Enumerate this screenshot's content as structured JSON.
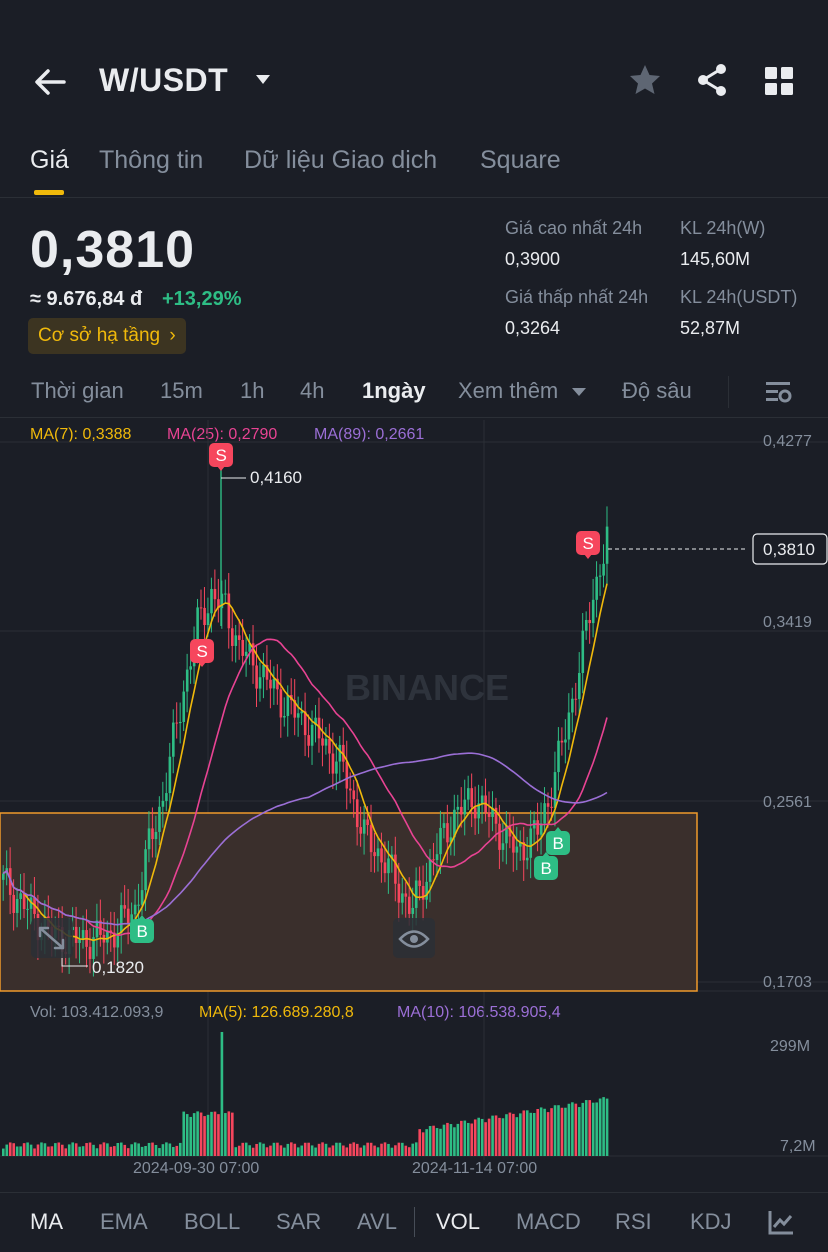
{
  "header": {
    "pair": "W/USDT"
  },
  "tabs": [
    "Giá",
    "Thông tin",
    "Dữ liệu Giao dịch",
    "Square"
  ],
  "price": {
    "last": "0,3810",
    "fiat": "≈ 9.676,84 đ",
    "change": "+13,29%",
    "tag": "Cơ sở hạ tầng"
  },
  "stats": {
    "high_label": "Giá cao nhất 24h",
    "high_value": "0,3900",
    "low_label": "Giá thấp nhất 24h",
    "low_value": "0,3264",
    "vol_base_label": "KL 24h(W)",
    "vol_base_value": "145,60M",
    "vol_quote_label": "KL 24h(USDT)",
    "vol_quote_value": "52,87M"
  },
  "intervals": {
    "time": "Thời gian",
    "m15": "15m",
    "h1": "1h",
    "h4": "4h",
    "d1": "1ngày",
    "more": "Xem thêm",
    "depth": "Độ sâu"
  },
  "ma_legend": {
    "ma7": "MA(7): 0,3388",
    "ma25": "MA(25): 0,2790",
    "ma89": "MA(89): 0,2661"
  },
  "vol_legend": {
    "vol": "Vol: 103.412.093,9",
    "ma5": "MA(5): 126.689.280,8",
    "ma10": "MA(10): 106.538.905,4"
  },
  "colors": {
    "up": "#2ebd85",
    "down": "#f6465d",
    "ma7": "#f0b90b",
    "ma25": "#e84393",
    "ma89": "#9b6fd6",
    "accent": "#f0b90b"
  },
  "watermark": "BINANCE",
  "chart_data": {
    "type": "candlestick",
    "y_ticks": [
      "0,4277",
      "0,3419",
      "0,2561",
      "0,1703"
    ],
    "y_range": [
      0.1703,
      0.4277
    ],
    "current_price_label": "0,3810",
    "high_annotation": "0,4160",
    "low_annotation": "0,1820",
    "vol_y_ticks": [
      "299M",
      "7,2M"
    ],
    "x_ticks": [
      "2024-09-30 07:00",
      "2024-11-14 07:00"
    ],
    "signals": [
      {
        "label": "S",
        "price": 0.416
      },
      {
        "label": "S",
        "price": 0.362
      },
      {
        "label": "S",
        "price": 0.386
      },
      {
        "label": "B",
        "price": 0.184
      },
      {
        "label": "B",
        "price": 0.222
      },
      {
        "label": "B",
        "price": 0.233
      }
    ],
    "series": [
      {
        "name": "MA(7)"
      },
      {
        "name": "MA(25)"
      },
      {
        "name": "MA(89)"
      }
    ]
  },
  "bottom_indicators": [
    "MA",
    "EMA",
    "BOLL",
    "SAR",
    "AVL",
    "VOL",
    "MACD",
    "RSI",
    "KDJ"
  ]
}
